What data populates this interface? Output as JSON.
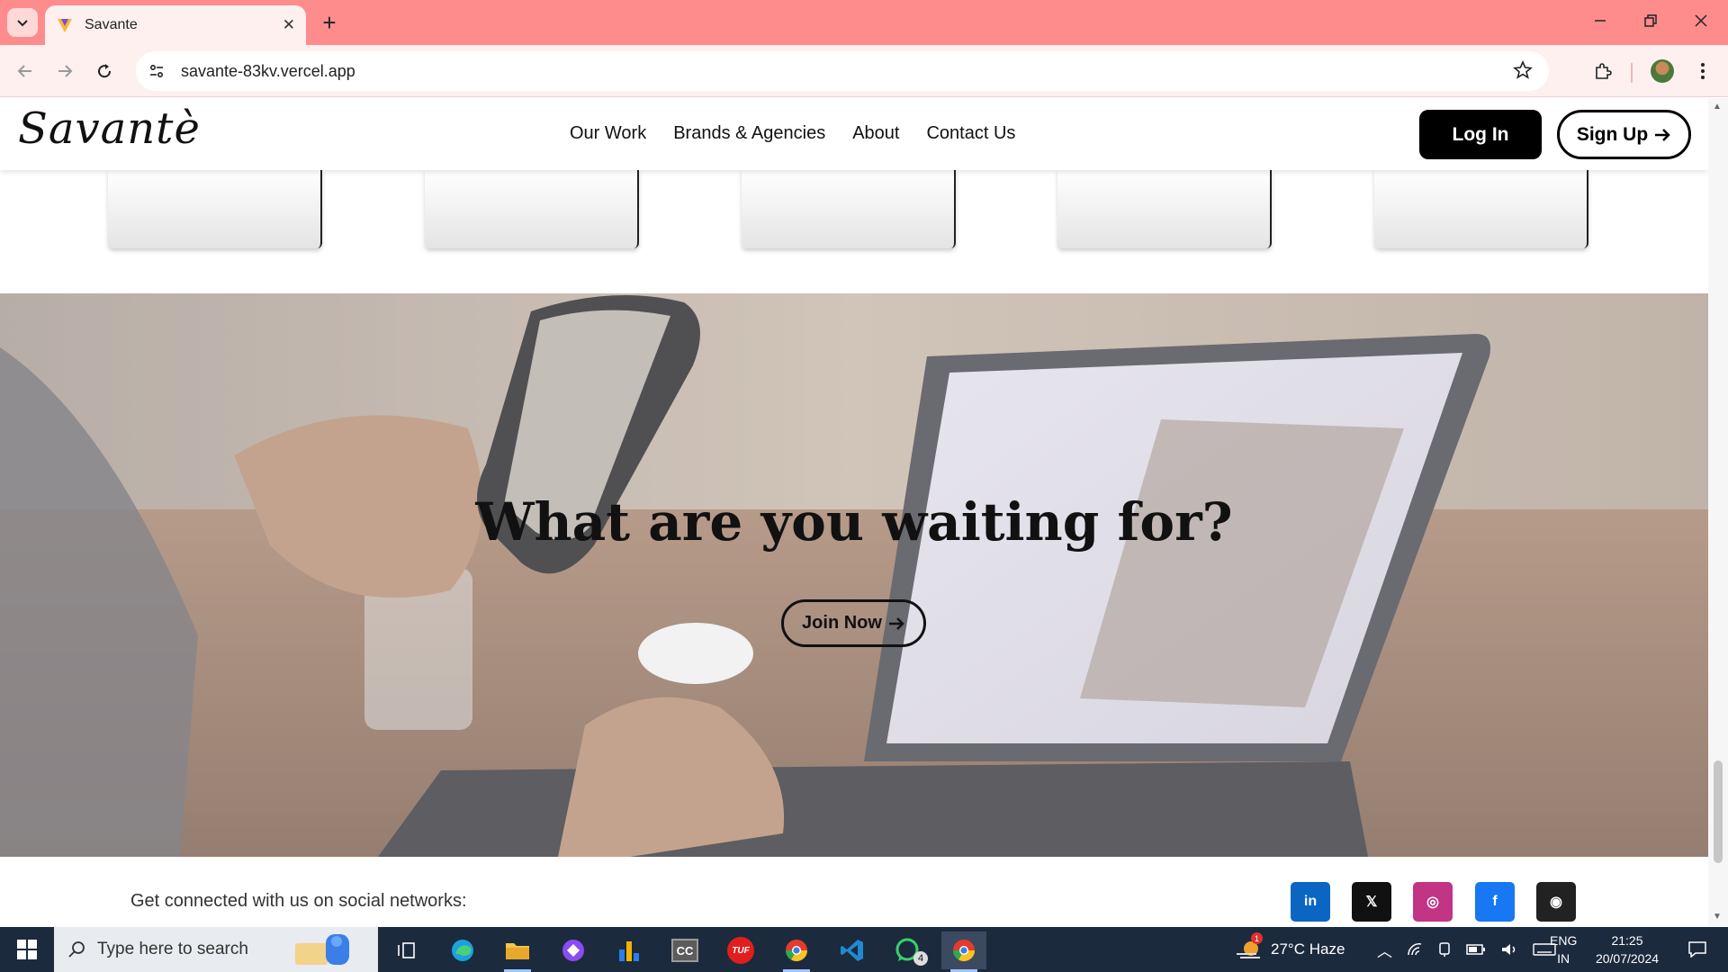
{
  "browser": {
    "tab_title": "Savante",
    "url": "savante-83kv.vercel.app",
    "new_tab_symbol": "+",
    "close_tab_symbol": "✕"
  },
  "site": {
    "logo": "Savantè",
    "nav": [
      "Our Work",
      "Brands & Agencies",
      "About",
      "Contact Us"
    ],
    "login_label": "Log In",
    "signup_label": "Sign Up"
  },
  "hero": {
    "title": "What are you waiting for?",
    "join_label": "Join Now"
  },
  "footer": {
    "social_text": "Get connected with us on social networks:",
    "social_icons": [
      {
        "name": "linkedin-icon",
        "glyph": "in",
        "color": "#0a66c2"
      },
      {
        "name": "x-icon",
        "glyph": "𝕏",
        "color": "#111111"
      },
      {
        "name": "instagram-icon",
        "glyph": "◎",
        "color": "#c13584"
      },
      {
        "name": "facebook-icon",
        "glyph": "f",
        "color": "#1877f2"
      },
      {
        "name": "github-icon",
        "glyph": "◉",
        "color": "#222222"
      }
    ]
  },
  "taskbar": {
    "search_placeholder": "Type here to search",
    "weather": "27°C  Haze",
    "weather_badge": "1",
    "lang_1": "ENG",
    "lang_2": "IN",
    "time": "21:25",
    "date": "20/07/2024",
    "whatsapp_badge": "4",
    "tuf_label": "TUF",
    "cc_label": "CC"
  },
  "colors": {
    "tabstrip": "#ff8c8c",
    "toolbar": "#fff0f0"
  }
}
